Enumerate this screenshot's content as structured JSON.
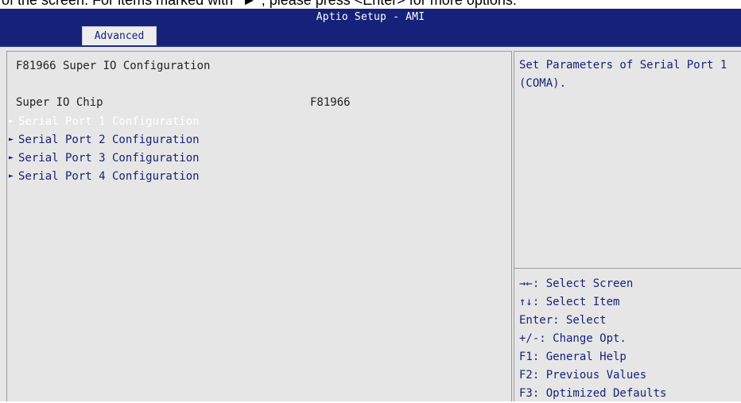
{
  "caption": "of the screen. For items marked with \"►\", please press <Enter> for more options.",
  "app_title": "Aptio Setup - AMI",
  "tabs": [
    {
      "label": "Advanced"
    }
  ],
  "main": {
    "section_title": "F81966 Super IO Configuration",
    "info": {
      "label": "Super IO Chip",
      "value": "F81966"
    },
    "items": [
      {
        "label": "Serial Port 1 Configuration",
        "selected": true
      },
      {
        "label": "Serial Port 2 Configuration",
        "selected": false
      },
      {
        "label": "Serial Port 3 Configuration",
        "selected": false
      },
      {
        "label": "Serial Port 4 Configuration",
        "selected": false
      }
    ],
    "submenu_arrow": "►"
  },
  "help": {
    "text": "Set Parameters of Serial Port 1 (COMA)."
  },
  "keys": [
    "→←: Select Screen",
    "↑↓: Select Item",
    "Enter: Select",
    "+/-: Change Opt.",
    "F1: General Help",
    "F2: Previous Values",
    "F3: Optimized Defaults"
  ],
  "colors": {
    "title_bar": "#16227a",
    "panel_bg": "#e6e6e6",
    "text_blue": "#16227a",
    "selected_text": "#ffffff"
  }
}
